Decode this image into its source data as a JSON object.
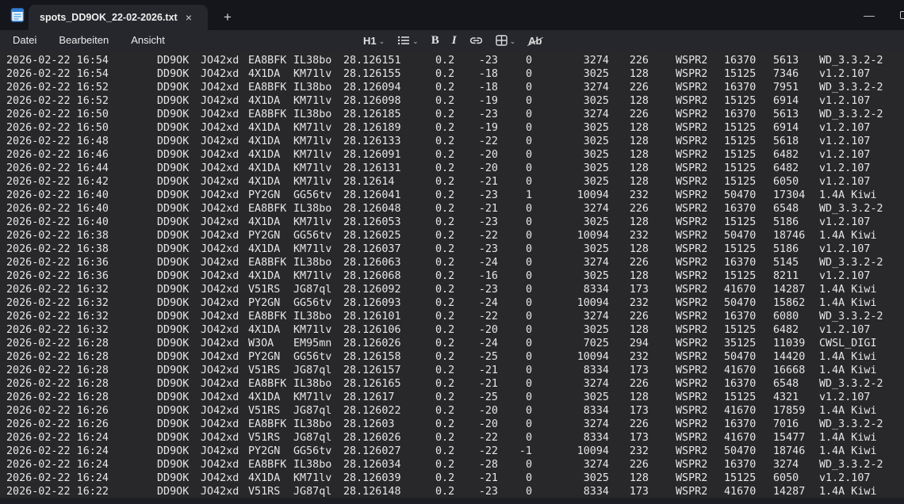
{
  "window": {
    "tab_title": "spots_DD9OK_22-02-2026.txt",
    "tab_close_glyph": "×",
    "new_tab_glyph": "+",
    "minimize_glyph": "—"
  },
  "menubar": {
    "file_label": "Datei",
    "edit_label": "Bearbeiten",
    "view_label": "Ansicht"
  },
  "toolbar": {
    "heading_label": "H1",
    "bold_label": "B",
    "italic_label": "I",
    "clear_format_label": "Ab",
    "chevron_glyph": "⌄"
  },
  "content": {
    "rows": [
      [
        "2026-02-22 16:54",
        "DD9OK",
        "JO42xd",
        "EA8BFK",
        "IL38bo",
        "28.126151",
        "0.2",
        "-23",
        "0",
        "3274",
        "226",
        "WSPR2",
        "16370",
        "5613",
        "WD_3.3.2-2"
      ],
      [
        "2026-02-22 16:54",
        "DD9OK",
        "JO42xd",
        "4X1DA",
        "KM71lv",
        "28.126155",
        "0.2",
        "-18",
        "0",
        "3025",
        "128",
        "WSPR2",
        "15125",
        "7346",
        "v1.2.107"
      ],
      [
        "2026-02-22 16:52",
        "DD9OK",
        "JO42xd",
        "EA8BFK",
        "IL38bo",
        "28.126094",
        "0.2",
        "-18",
        "0",
        "3274",
        "226",
        "WSPR2",
        "16370",
        "7951",
        "WD_3.3.2-2"
      ],
      [
        "2026-02-22 16:52",
        "DD9OK",
        "JO42xd",
        "4X1DA",
        "KM71lv",
        "28.126098",
        "0.2",
        "-19",
        "0",
        "3025",
        "128",
        "WSPR2",
        "15125",
        "6914",
        "v1.2.107"
      ],
      [
        "2026-02-22 16:50",
        "DD9OK",
        "JO42xd",
        "EA8BFK",
        "IL38bo",
        "28.126185",
        "0.2",
        "-23",
        "0",
        "3274",
        "226",
        "WSPR2",
        "16370",
        "5613",
        "WD_3.3.2-2"
      ],
      [
        "2026-02-22 16:50",
        "DD9OK",
        "JO42xd",
        "4X1DA",
        "KM71lv",
        "28.126189",
        "0.2",
        "-19",
        "0",
        "3025",
        "128",
        "WSPR2",
        "15125",
        "6914",
        "v1.2.107"
      ],
      [
        "2026-02-22 16:48",
        "DD9OK",
        "JO42xd",
        "4X1DA",
        "KM71lv",
        "28.126133",
        "0.2",
        "-22",
        "0",
        "3025",
        "128",
        "WSPR2",
        "15125",
        "5618",
        "v1.2.107"
      ],
      [
        "2026-02-22 16:46",
        "DD9OK",
        "JO42xd",
        "4X1DA",
        "KM71lv",
        "28.126091",
        "0.2",
        "-20",
        "0",
        "3025",
        "128",
        "WSPR2",
        "15125",
        "6482",
        "v1.2.107"
      ],
      [
        "2026-02-22 16:44",
        "DD9OK",
        "JO42xd",
        "4X1DA",
        "KM71lv",
        "28.126131",
        "0.2",
        "-20",
        "0",
        "3025",
        "128",
        "WSPR2",
        "15125",
        "6482",
        "v1.2.107"
      ],
      [
        "2026-02-22 16:42",
        "DD9OK",
        "JO42xd",
        "4X1DA",
        "KM71lv",
        "28.12614",
        "0.2",
        "-21",
        "0",
        "3025",
        "128",
        "WSPR2",
        "15125",
        "6050",
        "v1.2.107"
      ],
      [
        "2026-02-22 16:40",
        "DD9OK",
        "JO42xd",
        "PY2GN",
        "GG56tv",
        "28.126041",
        "0.2",
        "-23",
        "1",
        "10094",
        "232",
        "WSPR2",
        "50470",
        "17304",
        "1.4A Kiwi"
      ],
      [
        "2026-02-22 16:40",
        "DD9OK",
        "JO42xd",
        "EA8BFK",
        "IL38bo",
        "28.126048",
        "0.2",
        "-21",
        "0",
        "3274",
        "226",
        "WSPR2",
        "16370",
        "6548",
        "WD_3.3.2-2"
      ],
      [
        "2026-02-22 16:40",
        "DD9OK",
        "JO42xd",
        "4X1DA",
        "KM71lv",
        "28.126053",
        "0.2",
        "-23",
        "0",
        "3025",
        "128",
        "WSPR2",
        "15125",
        "5186",
        "v1.2.107"
      ],
      [
        "2026-02-22 16:38",
        "DD9OK",
        "JO42xd",
        "PY2GN",
        "GG56tv",
        "28.126025",
        "0.2",
        "-22",
        "0",
        "10094",
        "232",
        "WSPR2",
        "50470",
        "18746",
        "1.4A Kiwi"
      ],
      [
        "2026-02-22 16:38",
        "DD9OK",
        "JO42xd",
        "4X1DA",
        "KM71lv",
        "28.126037",
        "0.2",
        "-23",
        "0",
        "3025",
        "128",
        "WSPR2",
        "15125",
        "5186",
        "v1.2.107"
      ],
      [
        "2026-02-22 16:36",
        "DD9OK",
        "JO42xd",
        "EA8BFK",
        "IL38bo",
        "28.126063",
        "0.2",
        "-24",
        "0",
        "3274",
        "226",
        "WSPR2",
        "16370",
        "5145",
        "WD_3.3.2-2"
      ],
      [
        "2026-02-22 16:36",
        "DD9OK",
        "JO42xd",
        "4X1DA",
        "KM71lv",
        "28.126068",
        "0.2",
        "-16",
        "0",
        "3025",
        "128",
        "WSPR2",
        "15125",
        "8211",
        "v1.2.107"
      ],
      [
        "2026-02-22 16:32",
        "DD9OK",
        "JO42xd",
        "V51RS",
        "JG87ql",
        "28.126092",
        "0.2",
        "-23",
        "0",
        "8334",
        "173",
        "WSPR2",
        "41670",
        "14287",
        "1.4A Kiwi"
      ],
      [
        "2026-02-22 16:32",
        "DD9OK",
        "JO42xd",
        "PY2GN",
        "GG56tv",
        "28.126093",
        "0.2",
        "-24",
        "0",
        "10094",
        "232",
        "WSPR2",
        "50470",
        "15862",
        "1.4A Kiwi"
      ],
      [
        "2026-02-22 16:32",
        "DD9OK",
        "JO42xd",
        "EA8BFK",
        "IL38bo",
        "28.126101",
        "0.2",
        "-22",
        "0",
        "3274",
        "226",
        "WSPR2",
        "16370",
        "6080",
        "WD_3.3.2-2"
      ],
      [
        "2026-02-22 16:32",
        "DD9OK",
        "JO42xd",
        "4X1DA",
        "KM71lv",
        "28.126106",
        "0.2",
        "-20",
        "0",
        "3025",
        "128",
        "WSPR2",
        "15125",
        "6482",
        "v1.2.107"
      ],
      [
        "2026-02-22 16:28",
        "DD9OK",
        "JO42xd",
        "W3OA",
        "EM95mn",
        "28.126026",
        "0.2",
        "-24",
        "0",
        "7025",
        "294",
        "WSPR2",
        "35125",
        "11039",
        "CWSL_DIGI"
      ],
      [
        "2026-02-22 16:28",
        "DD9OK",
        "JO42xd",
        "PY2GN",
        "GG56tv",
        "28.126158",
        "0.2",
        "-25",
        "0",
        "10094",
        "232",
        "WSPR2",
        "50470",
        "14420",
        "1.4A Kiwi"
      ],
      [
        "2026-02-22 16:28",
        "DD9OK",
        "JO42xd",
        "V51RS",
        "JG87ql",
        "28.126157",
        "0.2",
        "-21",
        "0",
        "8334",
        "173",
        "WSPR2",
        "41670",
        "16668",
        "1.4A Kiwi"
      ],
      [
        "2026-02-22 16:28",
        "DD9OK",
        "JO42xd",
        "EA8BFK",
        "IL38bo",
        "28.126165",
        "0.2",
        "-21",
        "0",
        "3274",
        "226",
        "WSPR2",
        "16370",
        "6548",
        "WD_3.3.2-2"
      ],
      [
        "2026-02-22 16:28",
        "DD9OK",
        "JO42xd",
        "4X1DA",
        "KM71lv",
        "28.12617",
        "0.2",
        "-25",
        "0",
        "3025",
        "128",
        "WSPR2",
        "15125",
        "4321",
        "v1.2.107"
      ],
      [
        "2026-02-22 16:26",
        "DD9OK",
        "JO42xd",
        "V51RS",
        "JG87ql",
        "28.126022",
        "0.2",
        "-20",
        "0",
        "8334",
        "173",
        "WSPR2",
        "41670",
        "17859",
        "1.4A Kiwi"
      ],
      [
        "2026-02-22 16:26",
        "DD9OK",
        "JO42xd",
        "EA8BFK",
        "IL38bo",
        "28.12603",
        "0.2",
        "-20",
        "0",
        "3274",
        "226",
        "WSPR2",
        "16370",
        "7016",
        "WD_3.3.2-2"
      ],
      [
        "2026-02-22 16:24",
        "DD9OK",
        "JO42xd",
        "V51RS",
        "JG87ql",
        "28.126026",
        "0.2",
        "-22",
        "0",
        "8334",
        "173",
        "WSPR2",
        "41670",
        "15477",
        "1.4A Kiwi"
      ],
      [
        "2026-02-22 16:24",
        "DD9OK",
        "JO42xd",
        "PY2GN",
        "GG56tv",
        "28.126027",
        "0.2",
        "-22",
        "-1",
        "10094",
        "232",
        "WSPR2",
        "50470",
        "18746",
        "1.4A Kiwi"
      ],
      [
        "2026-02-22 16:24",
        "DD9OK",
        "JO42xd",
        "EA8BFK",
        "IL38bo",
        "28.126034",
        "0.2",
        "-28",
        "0",
        "3274",
        "226",
        "WSPR2",
        "16370",
        "3274",
        "WD_3.3.2-2"
      ],
      [
        "2026-02-22 16:24",
        "DD9OK",
        "JO42xd",
        "4X1DA",
        "KM71lv",
        "28.126039",
        "0.2",
        "-21",
        "0",
        "3025",
        "128",
        "WSPR2",
        "15125",
        "6050",
        "v1.2.107"
      ],
      [
        "2026-02-22 16:22",
        "DD9OK",
        "JO42xd",
        "V51RS",
        "JG87ql",
        "28.126148",
        "0.2",
        "-23",
        "0",
        "8334",
        "173",
        "WSPR2",
        "41670",
        "14287",
        "1.4A Kiwi"
      ]
    ]
  },
  "colors": {
    "titlebar_bg": "#15161c",
    "chrome_bg": "#26272d",
    "editor_bg": "#28282b",
    "statusbar_bg": "#1e1f24",
    "text": "#e6e6e6"
  }
}
